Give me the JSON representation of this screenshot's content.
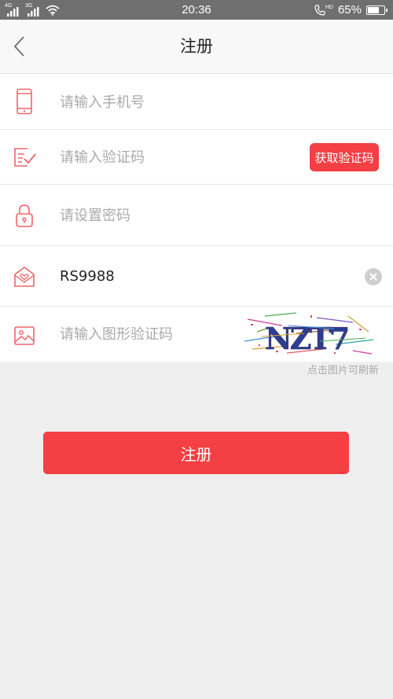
{
  "status_bar": {
    "time": "20:36",
    "battery": "65%",
    "battery_level": 0.65,
    "sim1_label": "4G",
    "sim2_label": "3G",
    "call_badge": "HD"
  },
  "nav": {
    "title": "注册",
    "back_icon": "chevron-left-icon"
  },
  "form": {
    "phone": {
      "placeholder": "请输入手机号",
      "value": "",
      "icon": "phone-icon"
    },
    "sms_code": {
      "placeholder": "请输入验证码",
      "value": "",
      "icon": "verify-icon",
      "button_label": "获取验证码"
    },
    "password": {
      "placeholder": "请设置密码",
      "value": "",
      "icon": "lock-icon"
    },
    "invite": {
      "placeholder": "",
      "value": "RS9988",
      "icon": "envelope-heart-icon"
    },
    "image_code": {
      "placeholder": "请输入图形验证码",
      "value": "",
      "icon": "image-icon",
      "captcha_text": "NZT7"
    }
  },
  "refresh_hint": "点击图片可刷新",
  "submit_label": "注册",
  "colors": {
    "accent": "#f43f44",
    "status_bar": "#6f6f6f",
    "page_bg": "#efefef"
  }
}
